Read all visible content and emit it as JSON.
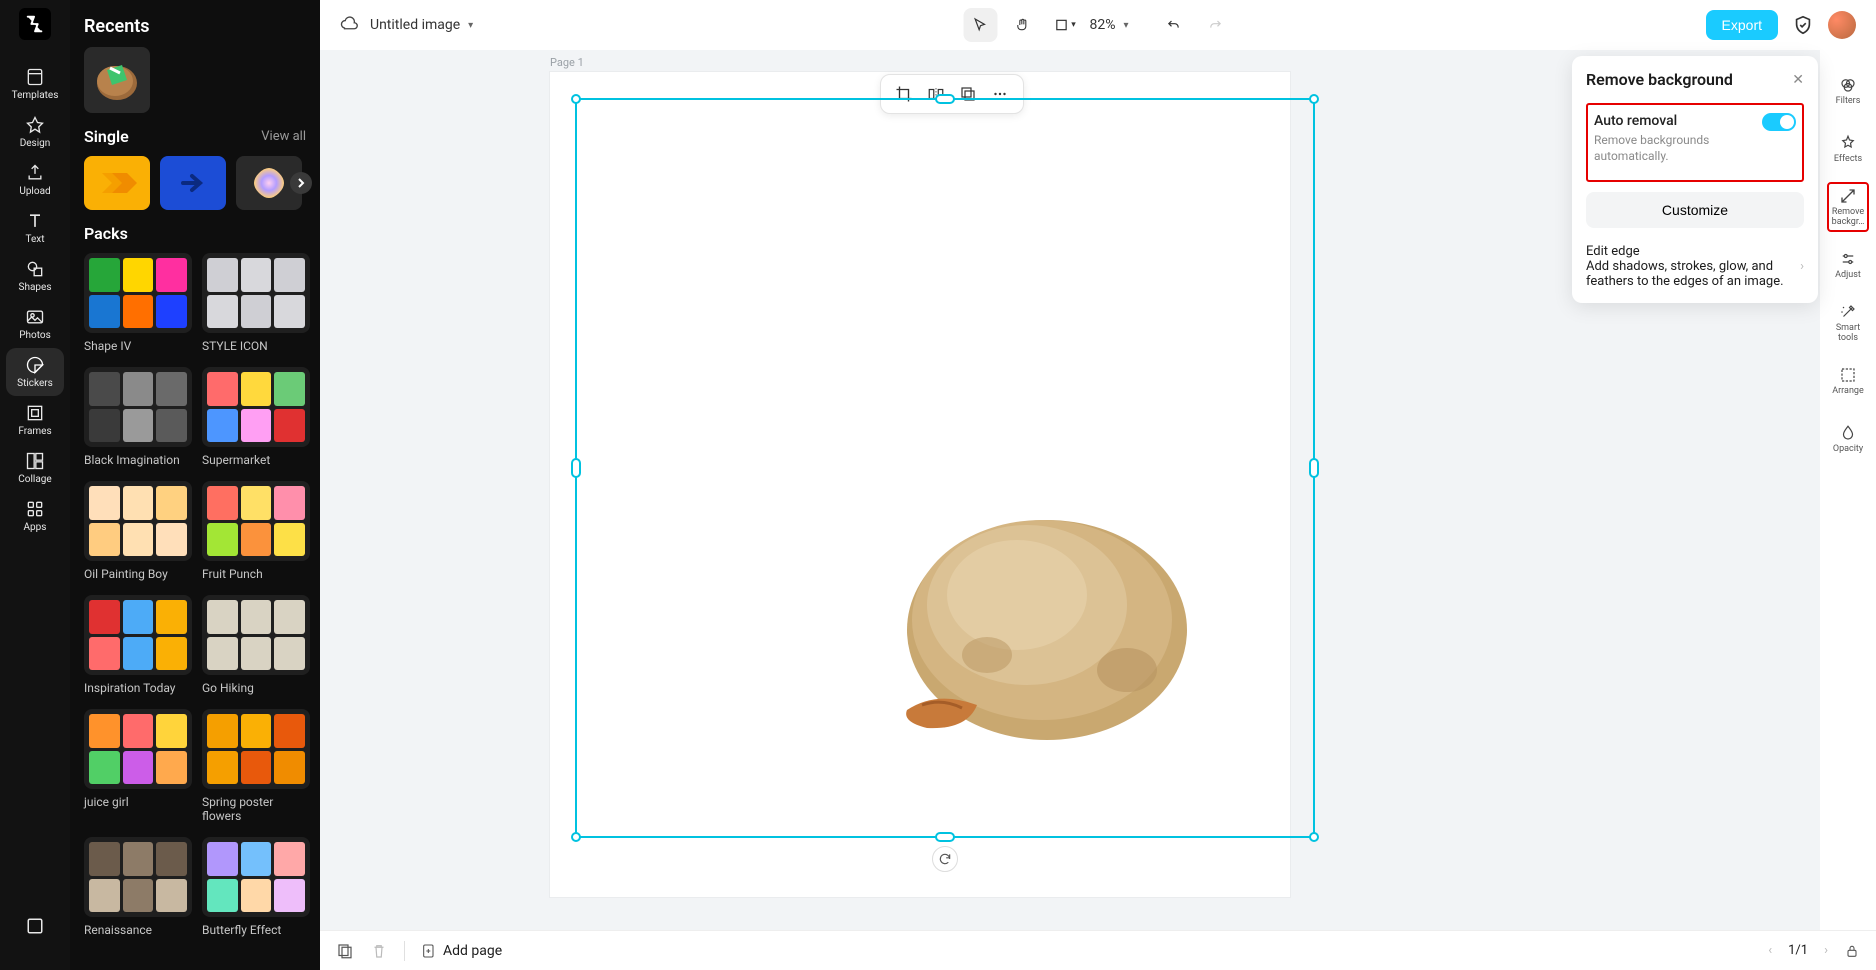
{
  "header": {
    "title": "Untitled image",
    "zoom": "82%",
    "export_label": "Export"
  },
  "leftnav": {
    "items": [
      {
        "id": "templates",
        "label": "Templates"
      },
      {
        "id": "design",
        "label": "Design"
      },
      {
        "id": "upload",
        "label": "Upload"
      },
      {
        "id": "text",
        "label": "Text"
      },
      {
        "id": "shapes",
        "label": "Shapes"
      },
      {
        "id": "photos",
        "label": "Photos"
      },
      {
        "id": "stickers",
        "label": "Stickers"
      },
      {
        "id": "frames",
        "label": "Frames"
      },
      {
        "id": "collage",
        "label": "Collage"
      },
      {
        "id": "apps",
        "label": "Apps"
      }
    ],
    "active": "stickers"
  },
  "stickers": {
    "recents_title": "Recents",
    "single_title": "Single",
    "view_all": "View all",
    "packs_title": "Packs",
    "packs": [
      {
        "name": "Shape IV"
      },
      {
        "name": "STYLE ICON"
      },
      {
        "name": "Black Imagination"
      },
      {
        "name": "Supermarket"
      },
      {
        "name": "Oil Painting Boy"
      },
      {
        "name": "Fruit Punch"
      },
      {
        "name": "Inspiration Today"
      },
      {
        "name": "Go Hiking"
      },
      {
        "name": "juice girl"
      },
      {
        "name": "Spring poster flowers"
      },
      {
        "name": "Renaissance"
      },
      {
        "name": "Butterfly Effect"
      }
    ]
  },
  "canvas": {
    "page_label": "Page 1"
  },
  "props_panel": {
    "title": "Remove background",
    "auto_removal_title": "Auto removal",
    "auto_removal_sub": "Remove backgrounds automatically.",
    "auto_removal_on": true,
    "customize_label": "Customize",
    "edit_edge_title": "Edit edge",
    "edit_edge_sub": "Add shadows, strokes, glow, and feathers to the edges of an image."
  },
  "rightnav": {
    "items": [
      {
        "id": "filters",
        "label": "Filters"
      },
      {
        "id": "effects",
        "label": "Effects"
      },
      {
        "id": "remove-bg",
        "label": "Remove backgr…"
      },
      {
        "id": "adjust",
        "label": "Adjust"
      },
      {
        "id": "smart",
        "label": "Smart tools"
      },
      {
        "id": "arrange",
        "label": "Arrange"
      },
      {
        "id": "opacity",
        "label": "Opacity"
      }
    ],
    "active": "remove-bg"
  },
  "bottombar": {
    "add_page": "Add page",
    "page_indicator": "1/1"
  },
  "pack_colors": [
    [
      "#26a639",
      "#ffd600",
      "#ff2fa0",
      "#1976d2",
      "#ff6f00",
      "#1e40ff"
    ],
    [
      "#cfcfd4",
      "#d8d8dc",
      "#cfcfd4",
      "#d8d8dc",
      "#cfcfd4",
      "#d8d8dc"
    ],
    [
      "#4a4a4a",
      "#8a8a8a",
      "#6a6a6a",
      "#3a3a3a",
      "#9a9a9a",
      "#5a5a5a"
    ],
    [
      "#ff6b6b",
      "#ffd93d",
      "#6bcB77",
      "#4d96ff",
      "#ff9ff3",
      "#e03131"
    ],
    [
      "#ffdfba",
      "#ffe0b2",
      "#ffd180",
      "#ffcc80",
      "#ffe0b2",
      "#ffdfba"
    ],
    [
      "#ff6f61",
      "#ffe066",
      "#ff8fab",
      "#a3e635",
      "#fb923c",
      "#fde047"
    ],
    [
      "#e03131",
      "#4dabf7",
      "#fab005",
      "#ff6b6b",
      "#4dabf7",
      "#fab005"
    ],
    [
      "#d9d3c3",
      "#d9d3c3",
      "#d9d3c3",
      "#d9d3c3",
      "#d9d3c3",
      "#d9d3c3"
    ],
    [
      "#ff922b",
      "#ff6b6b",
      "#ffd43b",
      "#51cf66",
      "#cc5de8",
      "#ffa94d"
    ],
    [
      "#f59f00",
      "#fab005",
      "#e8590c",
      "#f59f00",
      "#e8590c",
      "#f08c00"
    ],
    [
      "#6b5b4b",
      "#8d7b67",
      "#6b5b4b",
      "#c8b8a1",
      "#8d7b67",
      "#c8b8a1"
    ],
    [
      "#b197fc",
      "#74c0fc",
      "#ffa8a8",
      "#63e6be",
      "#ffd8a8",
      "#eebefa"
    ]
  ]
}
